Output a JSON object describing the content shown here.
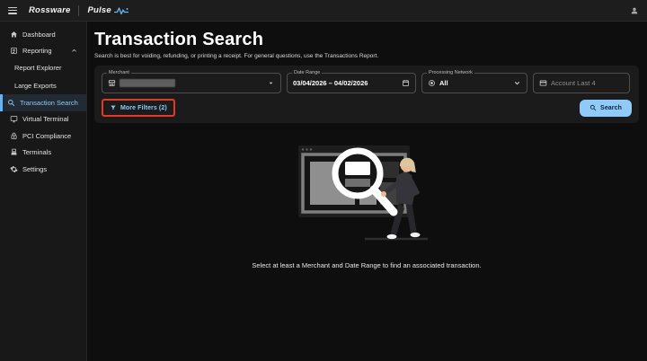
{
  "topbar": {
    "brand": "Rossware",
    "product": "Pulse"
  },
  "sidebar": {
    "items": [
      {
        "label": "Dashboard",
        "icon": "home-icon"
      },
      {
        "label": "Reporting",
        "icon": "report-icon",
        "expanded": true
      },
      {
        "label": "Report Explorer",
        "child": true
      },
      {
        "label": "Large Exports",
        "child": true
      },
      {
        "label": "Transaction Search",
        "icon": "search-icon",
        "selected": true
      },
      {
        "label": "Virtual Terminal",
        "icon": "monitor-icon"
      },
      {
        "label": "PCI Compliance",
        "icon": "lock-icon"
      },
      {
        "label": "Terminals",
        "icon": "terminal-icon"
      },
      {
        "label": "Settings",
        "icon": "gear-icon"
      }
    ]
  },
  "main": {
    "title": "Transaction Search",
    "subtitle": "Search is best for voiding, refunding, or printing a receipt. For general questions, use the Transactions Report.",
    "filters": {
      "merchant_label": "Merchant",
      "date_range_label": "Date Range",
      "date_range_value": "03/04/2026 – 04/02/2026",
      "processing_network_label": "Processing Network",
      "processing_network_value": "All",
      "account_last4_placeholder": "Account Last 4",
      "more_filters_label": "More Filters (2)",
      "search_label": "Search"
    },
    "empty_state_text": "Select at least a Merchant and Date Range to find an associated transaction."
  },
  "colors": {
    "accent_blue": "#90caf9",
    "selected_nav_blue": "#64b5f6",
    "annotation_red": "#e5372b",
    "search_button_bg": "#90caf9"
  }
}
